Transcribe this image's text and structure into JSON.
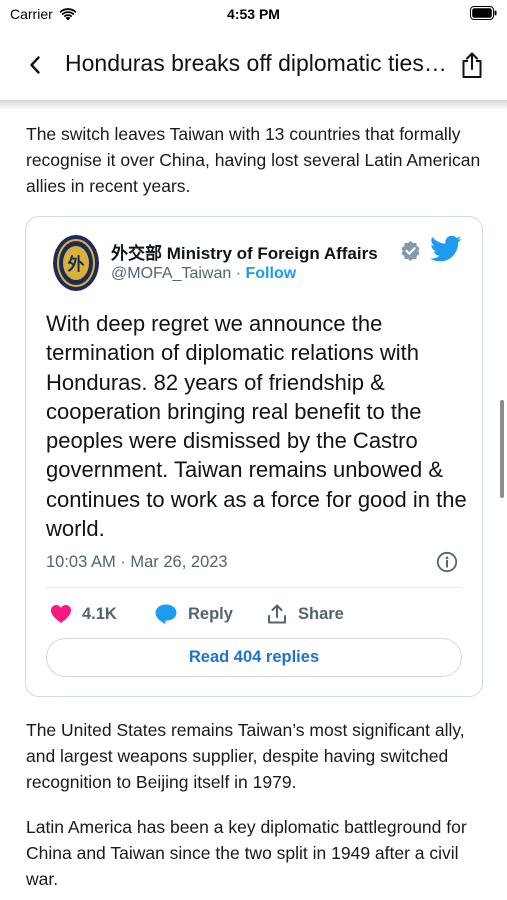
{
  "status_bar": {
    "carrier": "Carrier",
    "time": "4:53 PM"
  },
  "nav": {
    "title": "Honduras breaks off diplomatic ties with Taiwan in favour of China"
  },
  "article": {
    "paragraphs": [
      "The switch leaves Taiwan with 13 countries that formally recognise it over China, having lost several Latin American allies in recent years.",
      "The United States remains Taiwan’s most significant ally, and largest weapons supplier, despite having switched recognition to Beijing itself in 1979.",
      "Latin America has been a key diplomatic battleground for China and Taiwan since the two split in 1949 after a civil war."
    ]
  },
  "tweet": {
    "author_name": "外交部 Ministry of Foreign Affairs",
    "handle": "@MOFA_Taiwan",
    "separator": " · ",
    "follow_label": "Follow",
    "text": "With deep regret we announce the termination of diplomatic relations with Honduras. 82 years of friendship & cooperation bringing real benefit to the peoples were dismissed by the Castro government. Taiwan remains unbowed & continues to work as a force for good in the world.",
    "timestamp": "10:03 AM · Mar 26, 2023",
    "like_count": "4.1K",
    "reply_label": "Reply",
    "share_label": "Share",
    "read_replies_label": "Read 404 replies",
    "avatar_glyph": "外"
  },
  "icons": {
    "wifi": "wifi-icon",
    "battery": "battery-icon",
    "back": "chevron-left-icon",
    "share": "share-icon",
    "verified": "verified-badge-icon",
    "twitter": "twitter-bird-icon",
    "info": "info-icon",
    "like": "heart-icon",
    "reply": "speech-bubble-icon",
    "tweet_share": "upload-icon"
  },
  "colors": {
    "twitter_blue": "#1d9bf0",
    "like_pink": "#f91880",
    "avatar_navy": "#1d2a5c",
    "avatar_gold": "#d9b23a",
    "secondary_text": "#536471"
  }
}
